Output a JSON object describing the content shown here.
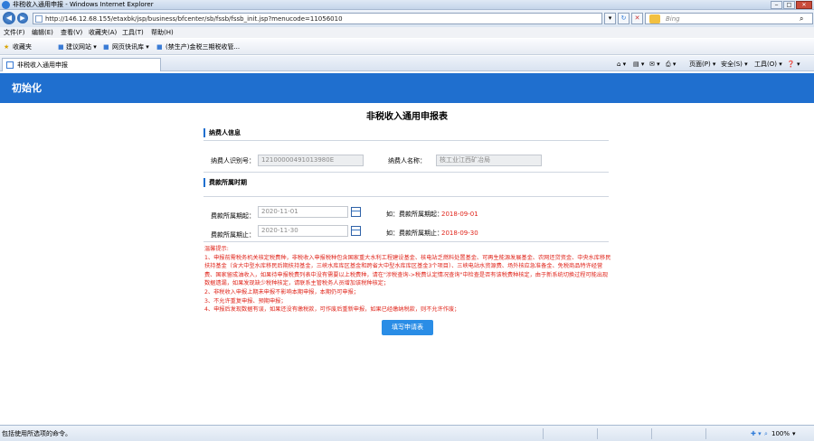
{
  "window": {
    "title": "非税收入通用申报 - Windows Internet Explorer",
    "controls": [
      "‒",
      "□",
      "✕"
    ]
  },
  "address_bar": {
    "url": "http://146.12.68.155/etaxbk/jsp/business/bfcenter/sb/fssb/fssb_init.jsp?menucode=11056010",
    "search_placeholder": "Bing"
  },
  "menu": [
    "文件(F)",
    "编辑(E)",
    "查看(V)",
    "收藏夹(A)",
    "工具(T)",
    "帮助(H)"
  ],
  "favorites_bar": {
    "favorites_label": "收藏夹",
    "items": [
      "建议网站 ▾",
      "网页快讯库 ▾",
      "(禁生产)金税三期税收管..."
    ]
  },
  "tab": {
    "label": "非税收入通用申报"
  },
  "toolbar": {
    "page_label": "页面(P) ▾",
    "safety_label": "安全(S) ▾",
    "tools_label": "工具(O) ▾",
    "help_label": "❓ ▾"
  },
  "header": {
    "title": "初始化"
  },
  "form": {
    "title": "非税收入通用申报表",
    "taxpayer_section": "纳费人信息",
    "taxpayer_id_label": "纳费人识别号：",
    "taxpayer_id_value": "12100000491013980E",
    "taxpayer_name_label": "纳费人名称：",
    "taxpayer_name_value": "核工业江西矿冶局",
    "period_section": "费款所属时期",
    "period_start_label": "费款所属期起：",
    "period_start_value": "2020-11-01",
    "period_end_label": "费款所属期止：",
    "period_end_value": "2020-11-30",
    "example_start_label": "如：费款所属期起：",
    "example_start_value": "2018-09-01",
    "example_end_label": "如：费款所属期止：",
    "example_end_value": "2018-09-30"
  },
  "notice": {
    "title": "温馨提示:",
    "lines": [
      "1、申报前需税务机关核定税费种，非税收入申报税种包含国家重大水利工程建设基金、核电站乏燃料处置基金、可再生能源发展基金、农网还贷资金、中央水库移民扶持基金（含大中型水库移民后期扶持基金，三峡水库库区基金和跨省大中型水库库区基金3个项目）、三峡电站水资源费、场外核应急准备金、免税商品特许经营费、国家留成油收入，如果待申报税费列表中没有需要以上税费种，请在\"涉税查询->税费认定情况查询\"中检查是否有该税费种核定，由于新系统切换过程可能出现数据遗漏，如果发现缺少税种核定，请联系主管税务人员增加该税种核定；",
      "2、非税收入申报上期未申报不影响本期申报，本期仍可申报；",
      "3、不允许重复申报、预期申报；",
      "4、申报后发现数据有误，如果还没有缴税款，可作废后重新申报，如果已经缴纳税款，则不允许作废；"
    ]
  },
  "submit_button": "填写申请表",
  "status": {
    "text": "包括使用所选项的命令。",
    "zoom": "100%"
  }
}
